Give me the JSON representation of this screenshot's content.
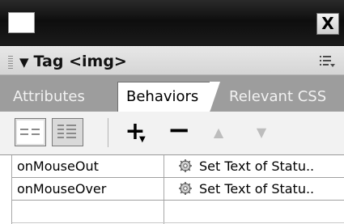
{
  "titlebar": {
    "close_label": "X"
  },
  "panel": {
    "title": "Tag <img>",
    "collapse_icon": "triangle-down-icon",
    "options_icon": "options-menu-icon"
  },
  "tabs": [
    {
      "label": "Attributes",
      "active": false
    },
    {
      "label": "Behaviors",
      "active": true
    },
    {
      "label": "Relevant CSS",
      "active": false
    }
  ],
  "toolbar": {
    "show_set_events_icon": "list-view-icon",
    "show_all_events_icon": "list-all-icon",
    "add_label": "+",
    "remove_label": "−",
    "move_up_icon": "up-arrow-icon",
    "move_down_icon": "down-arrow-icon"
  },
  "behaviors": [
    {
      "event": "onMouseOut",
      "action": "Set Text of Statu..",
      "action_icon": "behavior-gear-icon"
    },
    {
      "event": "onMouseOver",
      "action": "Set Text of Statu..",
      "action_icon": "behavior-gear-icon"
    }
  ],
  "colors": {
    "titlebar": "#111111",
    "tab_strip": "#9d9d9d",
    "active_tab": "#ffffff"
  }
}
